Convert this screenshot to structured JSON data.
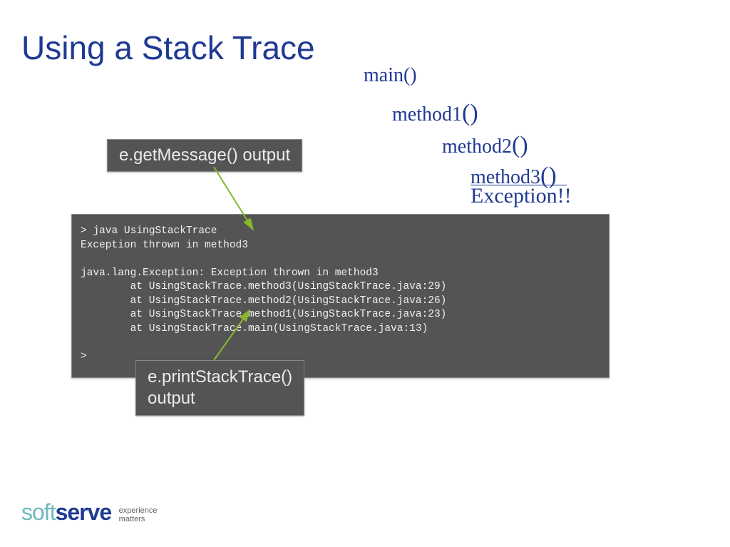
{
  "title": "Using a Stack Trace",
  "callstack": {
    "main": "main()",
    "method1_name": "method1",
    "method1_par": "()",
    "method2_name": "method2",
    "method2_par": "()",
    "method3_name": "method3",
    "method3_par": "()",
    "exception": "Exception!!"
  },
  "labels": {
    "getMessage": "e.getMessage() output",
    "printStackTrace": "e.printStackTrace()\noutput"
  },
  "terminal": "> java UsingStackTrace\nException thrown in method3\n\njava.lang.Exception: Exception thrown in method3\n        at UsingStackTrace.method3(UsingStackTrace.java:29)\n        at UsingStackTrace.method2(UsingStackTrace.java:26)\n        at UsingStackTrace.method1(UsingStackTrace.java:23)\n        at UsingStackTrace.main(UsingStackTrace.java:13)\n\n>",
  "logo": {
    "part1": "soft",
    "part2": "serve",
    "tagline1": "experience",
    "tagline2": "matters"
  }
}
